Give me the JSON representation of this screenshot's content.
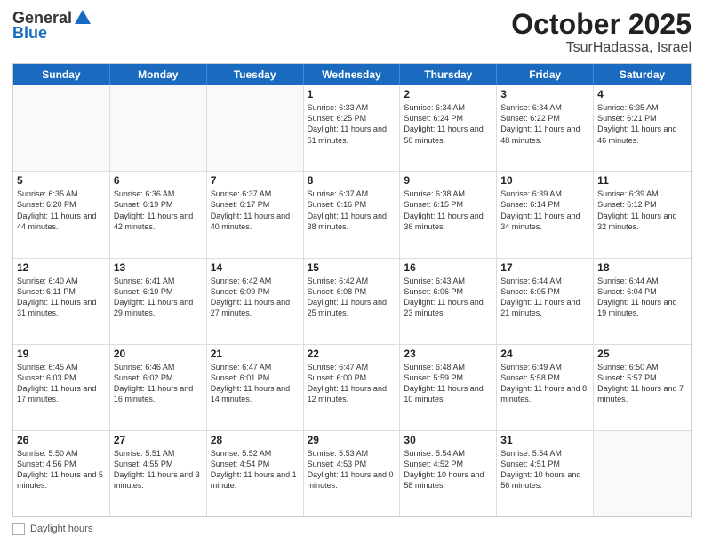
{
  "header": {
    "logo_general": "General",
    "logo_blue": "Blue",
    "title": "October 2025",
    "location": "TsurHadassa, Israel"
  },
  "days_of_week": [
    "Sunday",
    "Monday",
    "Tuesday",
    "Wednesday",
    "Thursday",
    "Friday",
    "Saturday"
  ],
  "weeks": [
    [
      {
        "day": "",
        "empty": true
      },
      {
        "day": "",
        "empty": true
      },
      {
        "day": "",
        "empty": true
      },
      {
        "day": "1",
        "sunrise": "Sunrise: 6:33 AM",
        "sunset": "Sunset: 6:25 PM",
        "daylight": "Daylight: 11 hours and 51 minutes."
      },
      {
        "day": "2",
        "sunrise": "Sunrise: 6:34 AM",
        "sunset": "Sunset: 6:24 PM",
        "daylight": "Daylight: 11 hours and 50 minutes."
      },
      {
        "day": "3",
        "sunrise": "Sunrise: 6:34 AM",
        "sunset": "Sunset: 6:22 PM",
        "daylight": "Daylight: 11 hours and 48 minutes."
      },
      {
        "day": "4",
        "sunrise": "Sunrise: 6:35 AM",
        "sunset": "Sunset: 6:21 PM",
        "daylight": "Daylight: 11 hours and 46 minutes."
      }
    ],
    [
      {
        "day": "5",
        "sunrise": "Sunrise: 6:35 AM",
        "sunset": "Sunset: 6:20 PM",
        "daylight": "Daylight: 11 hours and 44 minutes."
      },
      {
        "day": "6",
        "sunrise": "Sunrise: 6:36 AM",
        "sunset": "Sunset: 6:19 PM",
        "daylight": "Daylight: 11 hours and 42 minutes."
      },
      {
        "day": "7",
        "sunrise": "Sunrise: 6:37 AM",
        "sunset": "Sunset: 6:17 PM",
        "daylight": "Daylight: 11 hours and 40 minutes."
      },
      {
        "day": "8",
        "sunrise": "Sunrise: 6:37 AM",
        "sunset": "Sunset: 6:16 PM",
        "daylight": "Daylight: 11 hours and 38 minutes."
      },
      {
        "day": "9",
        "sunrise": "Sunrise: 6:38 AM",
        "sunset": "Sunset: 6:15 PM",
        "daylight": "Daylight: 11 hours and 36 minutes."
      },
      {
        "day": "10",
        "sunrise": "Sunrise: 6:39 AM",
        "sunset": "Sunset: 6:14 PM",
        "daylight": "Daylight: 11 hours and 34 minutes."
      },
      {
        "day": "11",
        "sunrise": "Sunrise: 6:39 AM",
        "sunset": "Sunset: 6:12 PM",
        "daylight": "Daylight: 11 hours and 32 minutes."
      }
    ],
    [
      {
        "day": "12",
        "sunrise": "Sunrise: 6:40 AM",
        "sunset": "Sunset: 6:11 PM",
        "daylight": "Daylight: 11 hours and 31 minutes."
      },
      {
        "day": "13",
        "sunrise": "Sunrise: 6:41 AM",
        "sunset": "Sunset: 6:10 PM",
        "daylight": "Daylight: 11 hours and 29 minutes."
      },
      {
        "day": "14",
        "sunrise": "Sunrise: 6:42 AM",
        "sunset": "Sunset: 6:09 PM",
        "daylight": "Daylight: 11 hours and 27 minutes."
      },
      {
        "day": "15",
        "sunrise": "Sunrise: 6:42 AM",
        "sunset": "Sunset: 6:08 PM",
        "daylight": "Daylight: 11 hours and 25 minutes."
      },
      {
        "day": "16",
        "sunrise": "Sunrise: 6:43 AM",
        "sunset": "Sunset: 6:06 PM",
        "daylight": "Daylight: 11 hours and 23 minutes."
      },
      {
        "day": "17",
        "sunrise": "Sunrise: 6:44 AM",
        "sunset": "Sunset: 6:05 PM",
        "daylight": "Daylight: 11 hours and 21 minutes."
      },
      {
        "day": "18",
        "sunrise": "Sunrise: 6:44 AM",
        "sunset": "Sunset: 6:04 PM",
        "daylight": "Daylight: 11 hours and 19 minutes."
      }
    ],
    [
      {
        "day": "19",
        "sunrise": "Sunrise: 6:45 AM",
        "sunset": "Sunset: 6:03 PM",
        "daylight": "Daylight: 11 hours and 17 minutes."
      },
      {
        "day": "20",
        "sunrise": "Sunrise: 6:46 AM",
        "sunset": "Sunset: 6:02 PM",
        "daylight": "Daylight: 11 hours and 16 minutes."
      },
      {
        "day": "21",
        "sunrise": "Sunrise: 6:47 AM",
        "sunset": "Sunset: 6:01 PM",
        "daylight": "Daylight: 11 hours and 14 minutes."
      },
      {
        "day": "22",
        "sunrise": "Sunrise: 6:47 AM",
        "sunset": "Sunset: 6:00 PM",
        "daylight": "Daylight: 11 hours and 12 minutes."
      },
      {
        "day": "23",
        "sunrise": "Sunrise: 6:48 AM",
        "sunset": "Sunset: 5:59 PM",
        "daylight": "Daylight: 11 hours and 10 minutes."
      },
      {
        "day": "24",
        "sunrise": "Sunrise: 6:49 AM",
        "sunset": "Sunset: 5:58 PM",
        "daylight": "Daylight: 11 hours and 8 minutes."
      },
      {
        "day": "25",
        "sunrise": "Sunrise: 6:50 AM",
        "sunset": "Sunset: 5:57 PM",
        "daylight": "Daylight: 11 hours and 7 minutes."
      }
    ],
    [
      {
        "day": "26",
        "sunrise": "Sunrise: 5:50 AM",
        "sunset": "Sunset: 4:56 PM",
        "daylight": "Daylight: 11 hours and 5 minutes."
      },
      {
        "day": "27",
        "sunrise": "Sunrise: 5:51 AM",
        "sunset": "Sunset: 4:55 PM",
        "daylight": "Daylight: 11 hours and 3 minutes."
      },
      {
        "day": "28",
        "sunrise": "Sunrise: 5:52 AM",
        "sunset": "Sunset: 4:54 PM",
        "daylight": "Daylight: 11 hours and 1 minute."
      },
      {
        "day": "29",
        "sunrise": "Sunrise: 5:53 AM",
        "sunset": "Sunset: 4:53 PM",
        "daylight": "Daylight: 11 hours and 0 minutes."
      },
      {
        "day": "30",
        "sunrise": "Sunrise: 5:54 AM",
        "sunset": "Sunset: 4:52 PM",
        "daylight": "Daylight: 10 hours and 58 minutes."
      },
      {
        "day": "31",
        "sunrise": "Sunrise: 5:54 AM",
        "sunset": "Sunset: 4:51 PM",
        "daylight": "Daylight: 10 hours and 56 minutes."
      },
      {
        "day": "",
        "empty": true
      }
    ]
  ],
  "footer": {
    "daylight_hours_label": "Daylight hours"
  }
}
